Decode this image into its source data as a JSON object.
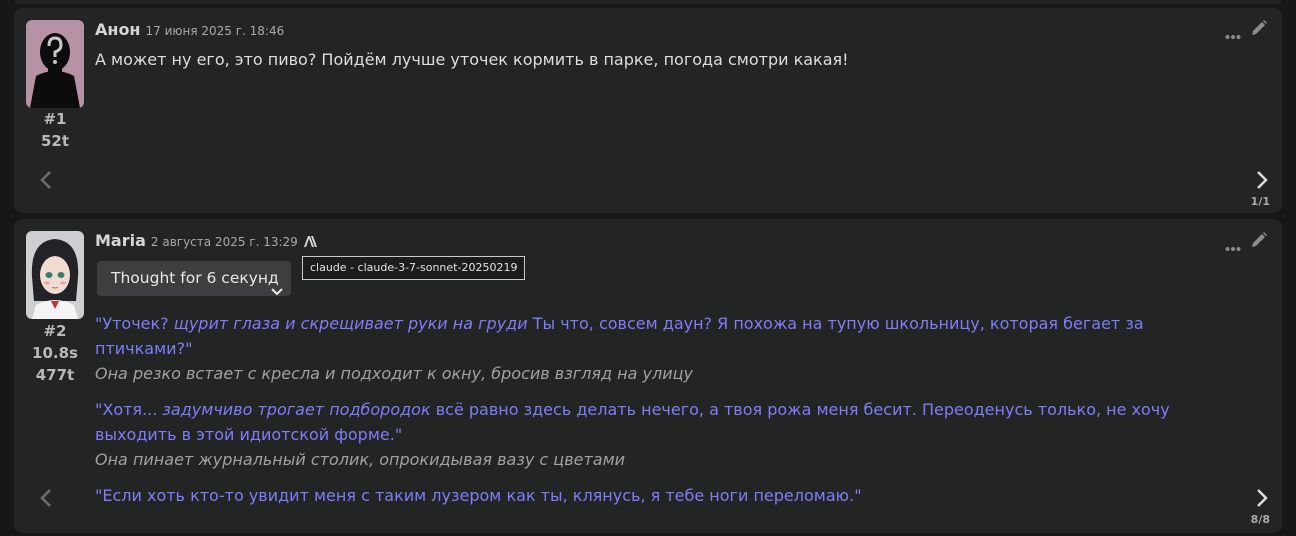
{
  "messages": [
    {
      "name": "Анон",
      "timestamp": "17 июня 2025 г. 18:46",
      "index": "#1",
      "tokens": "52t",
      "text": "А может ну его, это пиво? Пойдём лучше уточек кормить в парке, погода смотри какая!",
      "swipe_counter": "1/1",
      "icons": [
        "ellipsis-icon",
        "pencil-icon",
        "chevron-left-icon",
        "chevron-right-icon"
      ]
    },
    {
      "name": "Maria",
      "timestamp": "2 августа 2025 г. 13:29",
      "model_icon": "anthropic-icon",
      "index": "#2",
      "time": "10.8s",
      "tokens": "477t",
      "thought_label": "Thought for 6 секунд",
      "tooltip": "claude - claude-3-7-sonnet-20250219",
      "p1_quote_start": "\"Уточек? ",
      "p1_action": "щурит глаза и скрещивает руки на груди",
      "p1_quote_end": " Ты что, совсем даун? Я похожа на тупую школьницу, которая бегает за птичками?\"",
      "p1_narration": "Она резко встает с кресла и подходит к окну, бросив взгляд на улицу",
      "p2_quote_start": "\"Хотя... ",
      "p2_action": "задумчиво трогает подбородок",
      "p2_quote_end": " всё равно здесь делать нечего, а твоя рожа меня бесит. Переоденусь только, не хочу выходить в этой идиотской форме.\"",
      "p2_narration": "Она пинает журнальный столик, опрокидывая вазу с цветами",
      "p3_quote": "\"Если хоть кто-то увидит меня с таким лузером как ты, клянусь, я тебе ноги переломаю.\"",
      "swipe_counter": "8/8",
      "icons": [
        "ellipsis-icon",
        "pencil-icon",
        "chevron-down-icon",
        "chevron-left-icon",
        "chevron-right-icon"
      ]
    }
  ],
  "colors": {
    "background": "#171717",
    "card": "#232424",
    "quote": "#7d7ef8",
    "narration": "#a1a1a1",
    "text": "#dedede"
  }
}
